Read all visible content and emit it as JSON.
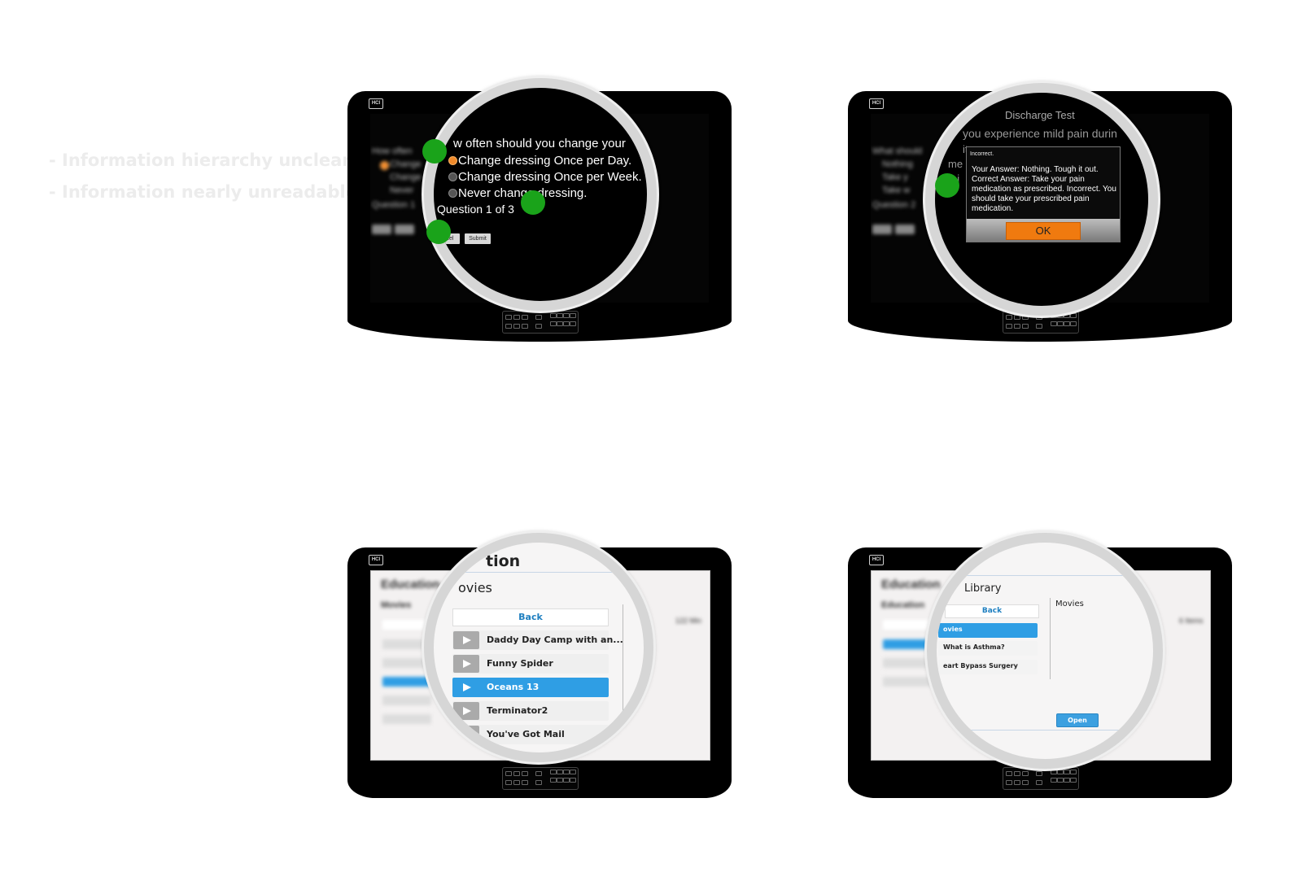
{
  "notes": [
    "- Information hierarchy unclear",
    "- Information nearly unreadable"
  ],
  "device_badge": "HCI",
  "quiz": {
    "question_fragment": "w often should you change your",
    "options": [
      "Change dressing Once per Day.",
      "Change dressing Once per Week.",
      "Never change dressing."
    ],
    "selected_index": 0,
    "progress": "Question 1 of 3",
    "cancel_label": "cel",
    "submit_label": "Submit",
    "bg_question": "How often",
    "bg_options": [
      "Change",
      "Change",
      "Never"
    ],
    "bg_progress": "Question 1"
  },
  "discharge": {
    "title": "Discharge Test",
    "question_fragment": "you experience mild pain durin",
    "bg_fragment_1": "it",
    "bg_fragment_2": "me",
    "bg_fragment_3": "ai",
    "bg_question": "What should",
    "bg_options": [
      "Nothing",
      "Take y",
      "Take w"
    ],
    "bg_progress": "Question 2",
    "dialog": {
      "title": "Incorrect.",
      "body": "Your Answer: Nothing.  Tough it out. Correct Answer: Take your pain medication as prescribed. Incorrect. You should take your prescribed pain medication.",
      "ok_label": "OK"
    }
  },
  "movies": {
    "header_fragment": "tion",
    "subheader_fragment": "ovies",
    "bg_header": "Education",
    "bg_subheader": "Movies",
    "back_label": "Back",
    "items": [
      "Daddy Day Camp with an...",
      "Funny Spider",
      "Oceans 13",
      "Terminator2",
      "You've Got Mail"
    ],
    "active_index": 2,
    "count": "122 Min"
  },
  "library": {
    "title": "Library",
    "bg_header": "Education",
    "bg_subheader": "Education",
    "back_label": "Back",
    "items": [
      "ovies",
      "What is Asthma?",
      "eart Bypass Surgery"
    ],
    "active_index": 0,
    "detail_title": "Movies",
    "open_label": "Open",
    "count": "6 Items"
  }
}
